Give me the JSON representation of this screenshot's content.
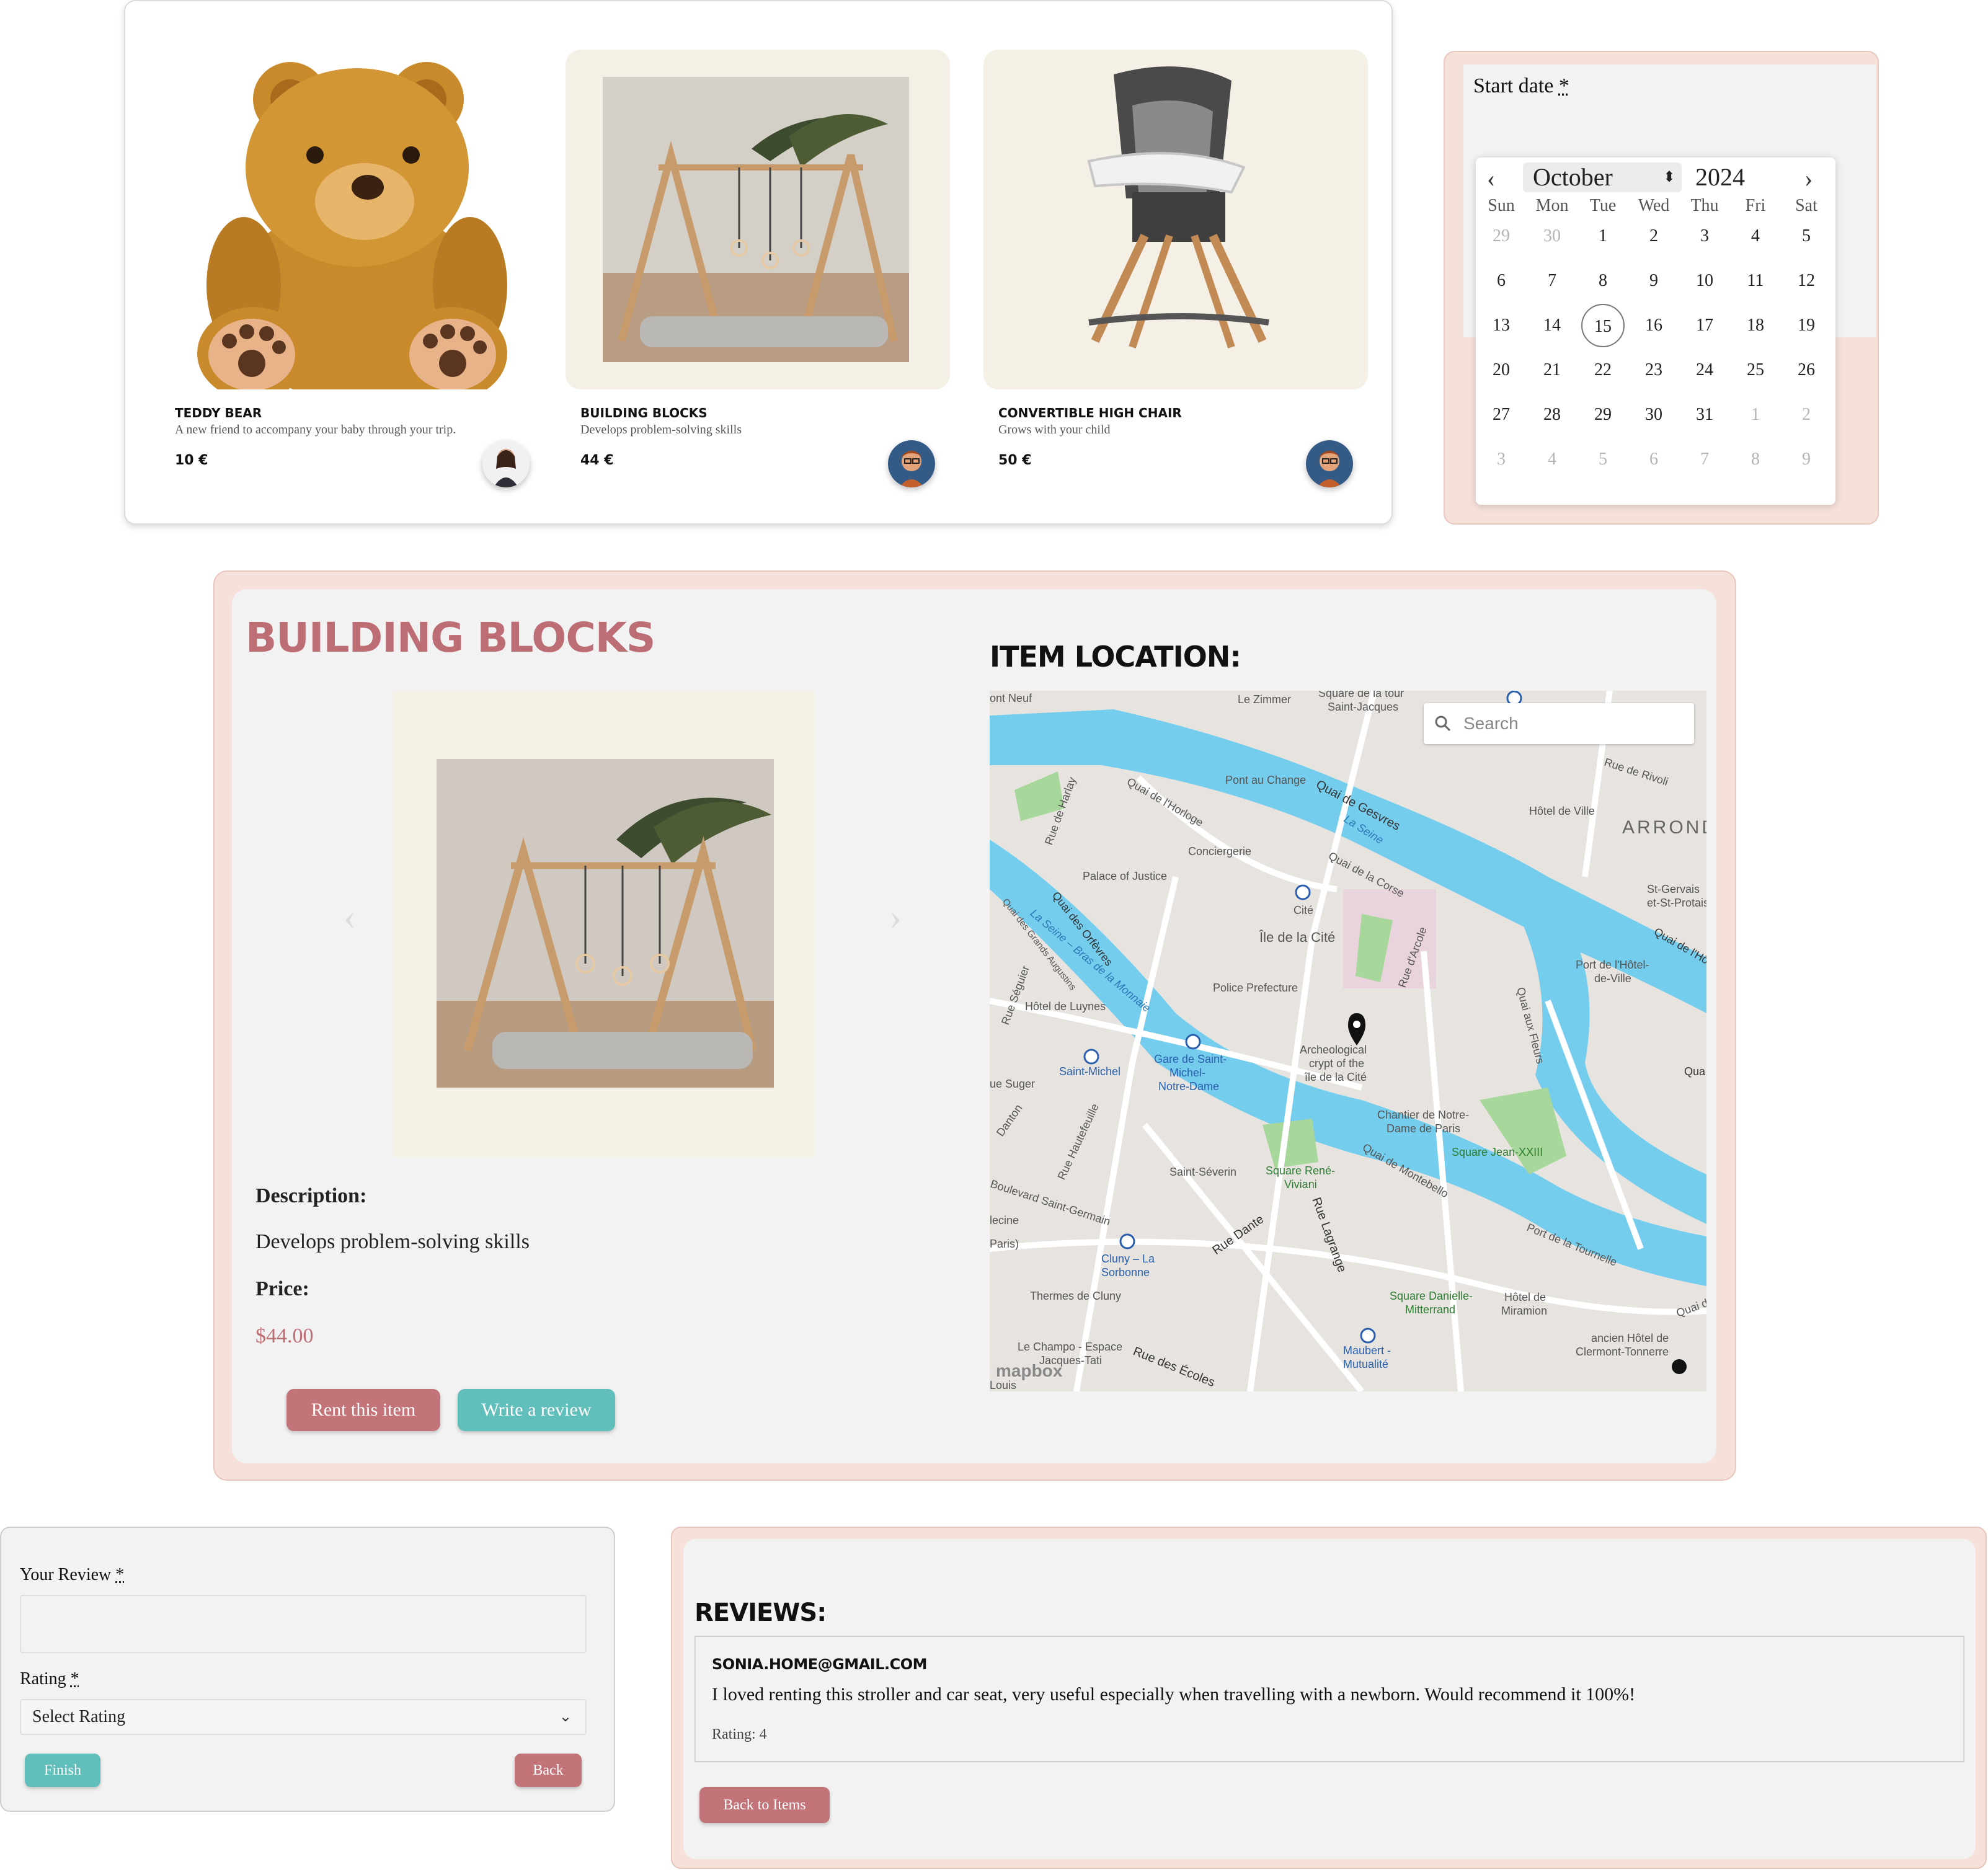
{
  "products": [
    {
      "name": "TEDDY BEAR",
      "description": "A new friend to accompany your baby through your trip.",
      "price": "10 €",
      "image": "teddy-bear"
    },
    {
      "name": "BUILDING BLOCKS",
      "description": "Develops problem-solving skills",
      "price": "44 €",
      "image": "baby-gym"
    },
    {
      "name": "CONVERTIBLE HIGH CHAIR",
      "description": "Grows with your child",
      "price": "50 €",
      "image": "high-chair"
    }
  ],
  "datepicker": {
    "label": "Start date",
    "required_mark": "*",
    "month": "October",
    "year": "2024",
    "weekdays": [
      "Sun",
      "Mon",
      "Tue",
      "Wed",
      "Thu",
      "Fri",
      "Sat"
    ],
    "days": [
      [
        "29",
        "30",
        "1",
        "2",
        "3",
        "4",
        "5"
      ],
      [
        "6",
        "7",
        "8",
        "9",
        "10",
        "11",
        "12"
      ],
      [
        "13",
        "14",
        "15",
        "16",
        "17",
        "18",
        "19"
      ],
      [
        "20",
        "21",
        "22",
        "23",
        "24",
        "25",
        "26"
      ],
      [
        "27",
        "28",
        "29",
        "30",
        "31",
        "1",
        "2"
      ],
      [
        "3",
        "4",
        "5",
        "6",
        "7",
        "8",
        "9"
      ]
    ],
    "selected_day": "15"
  },
  "detail": {
    "title": "BUILDING BLOCKS",
    "description_label": "Description:",
    "description": "Develops problem-solving skills",
    "price_label": "Price:",
    "price": "$44.00",
    "rent_button": "Rent this item",
    "review_button": "Write a review",
    "location_title": "ITEM LOCATION:"
  },
  "map": {
    "search_placeholder": "Search",
    "attribution": "mapbox",
    "labels": [
      "Pont Neuf",
      "Le Zimmer",
      "Square de la tour Saint-Jacques",
      "Quai de Gesvres",
      "Rue de Rivoli",
      "Hôtel de Ville",
      "ARROND",
      "Pont au Change",
      "Quai de l'Horloge",
      "Rue de Harlay",
      "Conciergerie",
      "Palace of Justice",
      "La Seine",
      "Quai de la Corse",
      "Cité",
      "Île de la Cité",
      "Quai des Orfèvres",
      "Quai des Grands Augustins",
      "La Seine – Bras de la Monnaie",
      "Police Prefecture",
      "Rue d'Arcole",
      "Hôtel de Luynes",
      "Rue Séguier",
      "Saint-Michel",
      "Gare de Saint-Michel-Notre-Dame",
      "Archeological crypt of the île de la Cité",
      "Rue Suger",
      "Rue Danton",
      "Rue Hautefeuille",
      "Chantier de Notre-Dame de Paris",
      "Square Jean-XXIII",
      "Saint-Séverin",
      "Square René-Viviani",
      "Quai de Montebello",
      "Boulevard Saint-Germain",
      "Cluny – La Sorbonne",
      "Rue Dante",
      "Rue Lagrange",
      "Thermes de Cluny",
      "Square Danielle-Mitterrand",
      "Hôtel de Miramion",
      "Port de la Tournelle",
      "Le Champo - Espace Jacques-Tati",
      "Rue des Écoles",
      "Maubert-Mutualité",
      "ancien Hôtel de Clermont-Tonnerre",
      "Quai aux Fleurs",
      "Port de l'Hôtel-de-Ville",
      "St-Gervais-et-St-Protais",
      "Quai de l'Hôtel",
      "Quai de",
      "Saint-Louis"
    ]
  },
  "review_form": {
    "review_label": "Your Review",
    "rating_label": "Rating",
    "required_mark": "*",
    "rating_value": "Select Rating",
    "finish_button": "Finish",
    "back_button": "Back"
  },
  "reviews": {
    "title": "REVIEWS:",
    "items": [
      {
        "user": "SONIA.HOME@GMAIL.COM",
        "text": "I loved renting this stroller and car seat, very useful especially when travelling with a newborn. Would recommend it 100%!",
        "rating": "Rating: 4"
      }
    ],
    "back_button": "Back to Items"
  }
}
